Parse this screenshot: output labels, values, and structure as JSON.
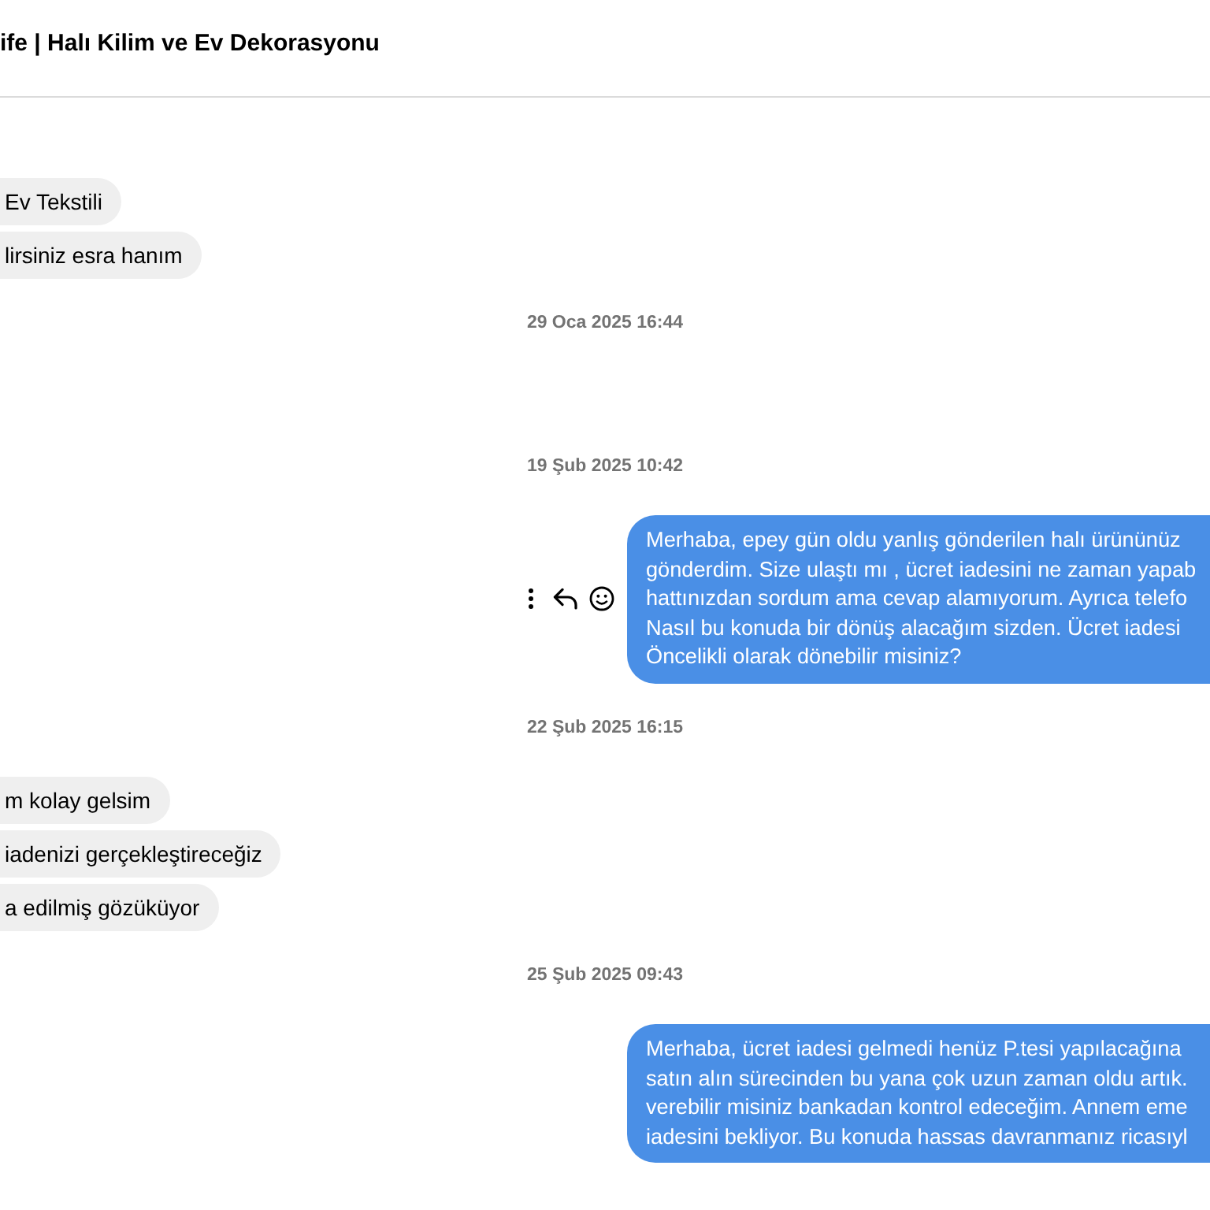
{
  "header": {
    "title": "ife | Halı Kilim ve Ev Dekorasyonu"
  },
  "messages": [
    {
      "kind": "received",
      "text": "Ev Tekstili"
    },
    {
      "kind": "received",
      "text": "lirsiniz esra hanım"
    },
    {
      "kind": "timestamp",
      "text": "29 Oca 2025 16:44"
    },
    {
      "kind": "timestamp",
      "text": "19 Şub 2025 10:42"
    },
    {
      "kind": "sent",
      "hovered": true,
      "text": "Merhaba, epey gün oldu yanlış gönderilen halı ürününüz\ngönderdim. Size ulaştı mı , ücret iadesini ne zaman yapab\nhattınızdan sordum ama cevap alamıyorum. Ayrıca telefo\nNasıl bu konuda bir dönüş alacağım sizden. Ücret iadesi\nÖncelikli olarak dönebilir misiniz?"
    },
    {
      "kind": "timestamp",
      "text": "22 Şub 2025 16:15"
    },
    {
      "kind": "received",
      "text": "m kolay gelsim"
    },
    {
      "kind": "received",
      "text": "iadenizi gerçekleştireceğiz"
    },
    {
      "kind": "received",
      "text": "a edilmiş gözüküyor"
    },
    {
      "kind": "timestamp",
      "text": "25 Şub 2025 09:43"
    },
    {
      "kind": "sent",
      "hovered": false,
      "text": "Merhaba, ücret iadesi gelmedi henüz P.tesi yapılacağına\nsatın alın sürecinden bu yana çok uzun zaman oldu artık.\nverebilir misiniz bankadan kontrol edeceğim. Annem eme\niadesini bekliyor. Bu konuda hassas davranmanız ricasıyl"
    }
  ]
}
